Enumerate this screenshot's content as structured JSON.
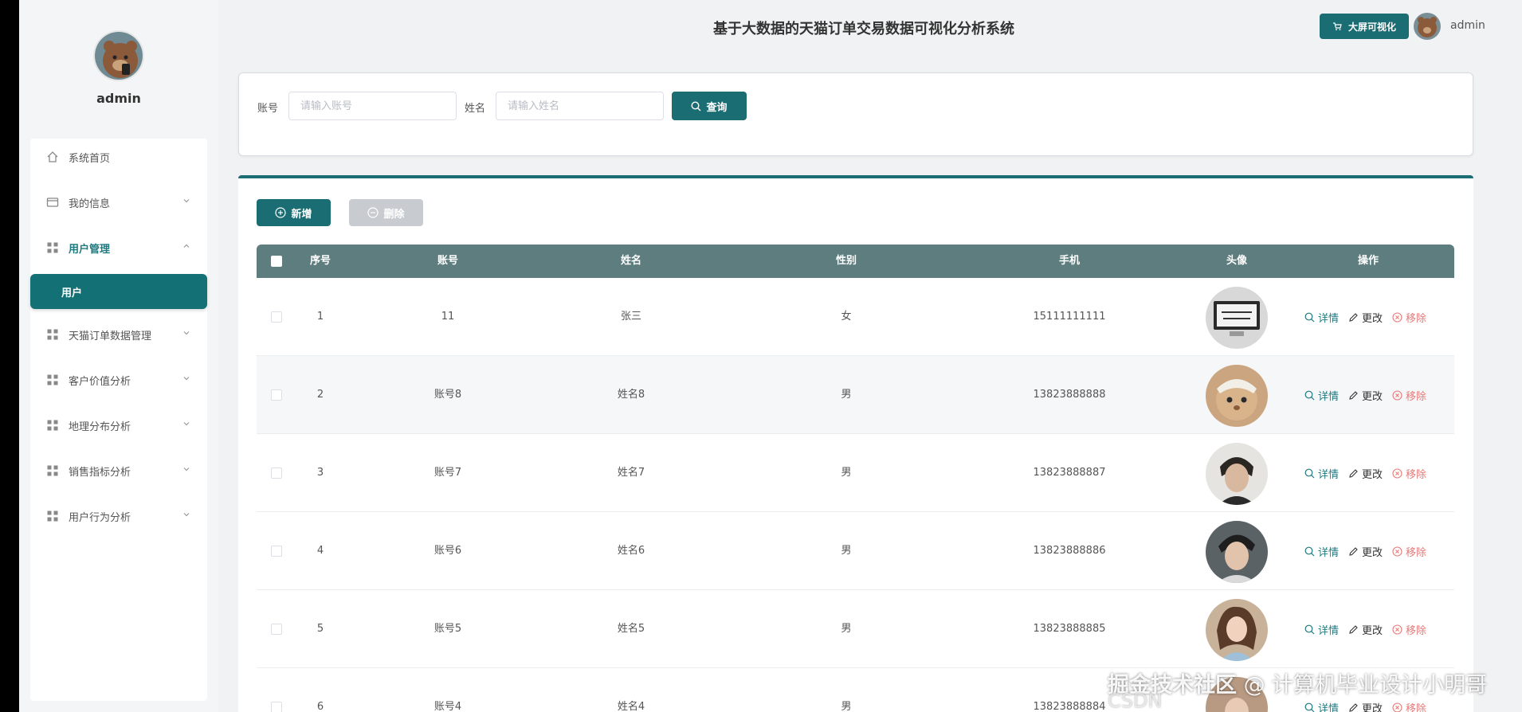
{
  "sidebar": {
    "username": "admin",
    "menu": [
      {
        "label": "系统首页"
      },
      {
        "label": "我的信息"
      },
      {
        "label": "用户管理"
      },
      {
        "label": "天猫订单数据管理"
      },
      {
        "label": "客户价值分析"
      },
      {
        "label": "地理分布分析"
      },
      {
        "label": "销售指标分析"
      },
      {
        "label": "用户行为分析"
      }
    ],
    "submenu_active": "用户"
  },
  "header": {
    "title": "基于大数据的天猫订单交易数据可视化分析系统",
    "bigscreen_label": "大屏可视化",
    "username": "admin"
  },
  "search": {
    "account_label": "账号",
    "account_placeholder": "请输入账号",
    "name_label": "姓名",
    "name_placeholder": "请输入姓名",
    "query_label": "查询"
  },
  "toolbar": {
    "add_label": "新增",
    "delete_label": "删除"
  },
  "table": {
    "columns": [
      "序号",
      "账号",
      "姓名",
      "性别",
      "手机",
      "头像",
      "操作"
    ],
    "rows": [
      {
        "index": "1",
        "account": "11",
        "name": "张三",
        "gender": "女",
        "phone": "15111111111"
      },
      {
        "index": "2",
        "account": "账号8",
        "name": "姓名8",
        "gender": "男",
        "phone": "13823888888"
      },
      {
        "index": "3",
        "account": "账号7",
        "name": "姓名7",
        "gender": "男",
        "phone": "13823888887"
      },
      {
        "index": "4",
        "account": "账号6",
        "name": "姓名6",
        "gender": "男",
        "phone": "13823888886"
      },
      {
        "index": "5",
        "account": "账号5",
        "name": "姓名5",
        "gender": "男",
        "phone": "13823888885"
      },
      {
        "index": "6",
        "account": "账号4",
        "name": "姓名4",
        "gender": "男",
        "phone": "13823888884"
      }
    ],
    "actions": {
      "detail": "详情",
      "edit": "更改",
      "remove": "移除"
    }
  },
  "watermark": {
    "part1": "掘金技术社区",
    "part2": "@ 计算机毕业设计小明哥",
    "part3": "CSDN"
  },
  "colors": {
    "accent": "#1a6d73",
    "header_row": "#5e7d7f",
    "remove": "#e87a7a"
  }
}
